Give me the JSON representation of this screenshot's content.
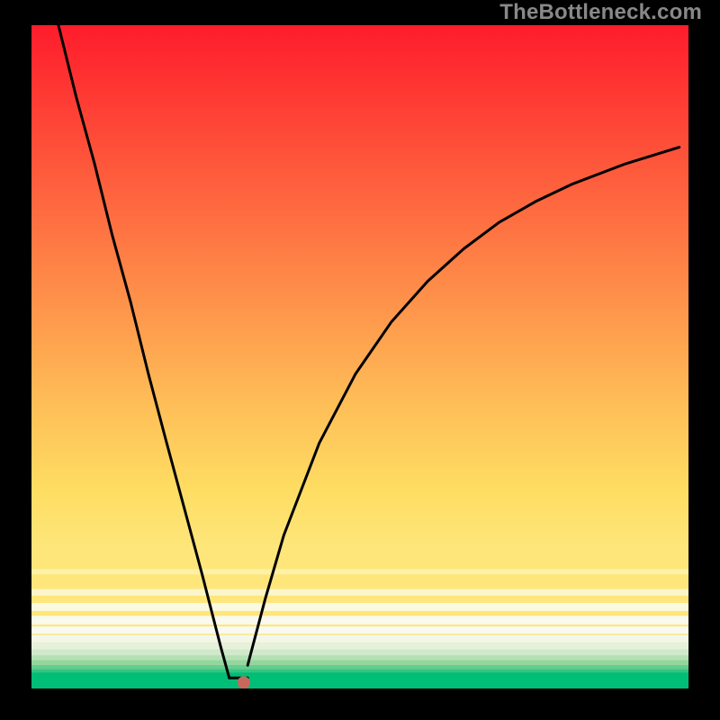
{
  "watermark": "TheBottleneck.com",
  "chart_data": {
    "type": "line",
    "title": "",
    "xlabel": "",
    "ylabel": "",
    "xlim": [
      0,
      100
    ],
    "ylim": [
      0,
      100
    ],
    "grid": false,
    "legend": false,
    "lines": [
      {
        "name": "left-branch",
        "x": [
          4.1,
          6.8,
          9.6,
          12.3,
          15.1,
          17.8,
          20.5,
          26.0,
          28.8,
          30.1
        ],
        "y": [
          100.0,
          89.2,
          79.1,
          68.3,
          58.2,
          47.4,
          37.3,
          17.1,
          6.3,
          1.6
        ]
      },
      {
        "name": "flat-segment",
        "x": [
          30.1,
          32.9
        ],
        "y": [
          1.6,
          1.6
        ]
      },
      {
        "name": "right-branch",
        "x": [
          32.9,
          35.6,
          38.4,
          43.8,
          49.3,
          54.8,
          60.3,
          65.8,
          71.2,
          76.7,
          82.2,
          90.4,
          98.6
        ],
        "y": [
          3.5,
          13.6,
          23.1,
          37.0,
          47.4,
          55.3,
          61.4,
          66.3,
          70.3,
          73.4,
          76.0,
          79.1,
          81.6
        ]
      }
    ],
    "marker": {
      "x": 32.3,
      "y": 0.9
    },
    "bottom_band": {
      "y_start": 0,
      "y_end": 2.4
    },
    "bands_on_gradient": [
      {
        "y": 20.8,
        "color": "#fee67b",
        "thickness": 0.6
      },
      {
        "y": 17.6,
        "color": "#fcf1a5",
        "thickness": 0.8
      },
      {
        "y": 14.5,
        "color": "#fbf6c9",
        "thickness": 1.0
      },
      {
        "y": 12.3,
        "color": "#fafae1",
        "thickness": 1.2
      },
      {
        "y": 10.3,
        "color": "#f9faed",
        "thickness": 1.3
      },
      {
        "y": 8.8,
        "color": "#f7f9f2",
        "thickness": 1.1
      },
      {
        "y": 7.5,
        "color": "#f2f7ed",
        "thickness": 1.1
      },
      {
        "y": 6.4,
        "color": "#e4f1dd",
        "thickness": 1.0
      },
      {
        "y": 5.4,
        "color": "#cfe9c9",
        "thickness": 0.9
      },
      {
        "y": 4.6,
        "color": "#b4e0b3",
        "thickness": 0.8
      },
      {
        "y": 3.9,
        "color": "#92d6a0",
        "thickness": 0.7
      },
      {
        "y": 3.2,
        "color": "#66cd8f",
        "thickness": 0.7
      },
      {
        "y": 2.6,
        "color": "#35c481",
        "thickness": 0.6
      }
    ]
  }
}
